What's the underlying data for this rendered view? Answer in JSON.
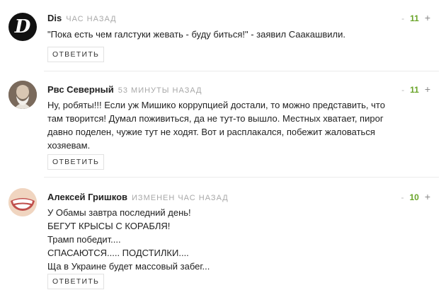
{
  "comments": [
    {
      "author": "Dis",
      "meta": "ЧАС НАЗАД",
      "vote_minus": "-",
      "score": "11",
      "vote_plus": "+",
      "lines": [
        "\"Пока есть чем галстуки жевать - буду биться!\" - заявил Саакашвили."
      ],
      "reply_label": "ОТВЕТИТЬ",
      "avatar_letter": "D"
    },
    {
      "author": "Рвс Северный",
      "meta": "53 МИНУТЫ НАЗАД",
      "vote_minus": "-",
      "score": "11",
      "vote_plus": "+",
      "lines": [
        "Ну, робяты!!! Если уж Мишико коррупцией достали, то можно представить, что",
        "там творится! Думал поживиться, да не тут-то вышло. Местных хватает, пирог",
        "давно поделен, чужие тут не ходят. Вот и расплакался, побежит жаловаться",
        "хозяевам."
      ],
      "reply_label": "ОТВЕТИТЬ"
    },
    {
      "author": "Алексей Гришков",
      "meta": "ИЗМЕНЕН ЧАС НАЗАД",
      "vote_minus": "-",
      "score": "10",
      "vote_plus": "+",
      "lines": [
        "У Обамы завтра последний день!",
        "БЕГУТ КРЫСЫ С КОРАБЛЯ!",
        "Трамп победит....",
        "СПАСАЮТСЯ..... ПОДСТИЛКИ....",
        "Ща в Украине будет массовый забег..."
      ],
      "reply_label": "ОТВЕТИТЬ"
    }
  ],
  "colors": {
    "score": "#6aa52a",
    "meta": "#a8a8a8",
    "separator": "#ebebeb"
  }
}
